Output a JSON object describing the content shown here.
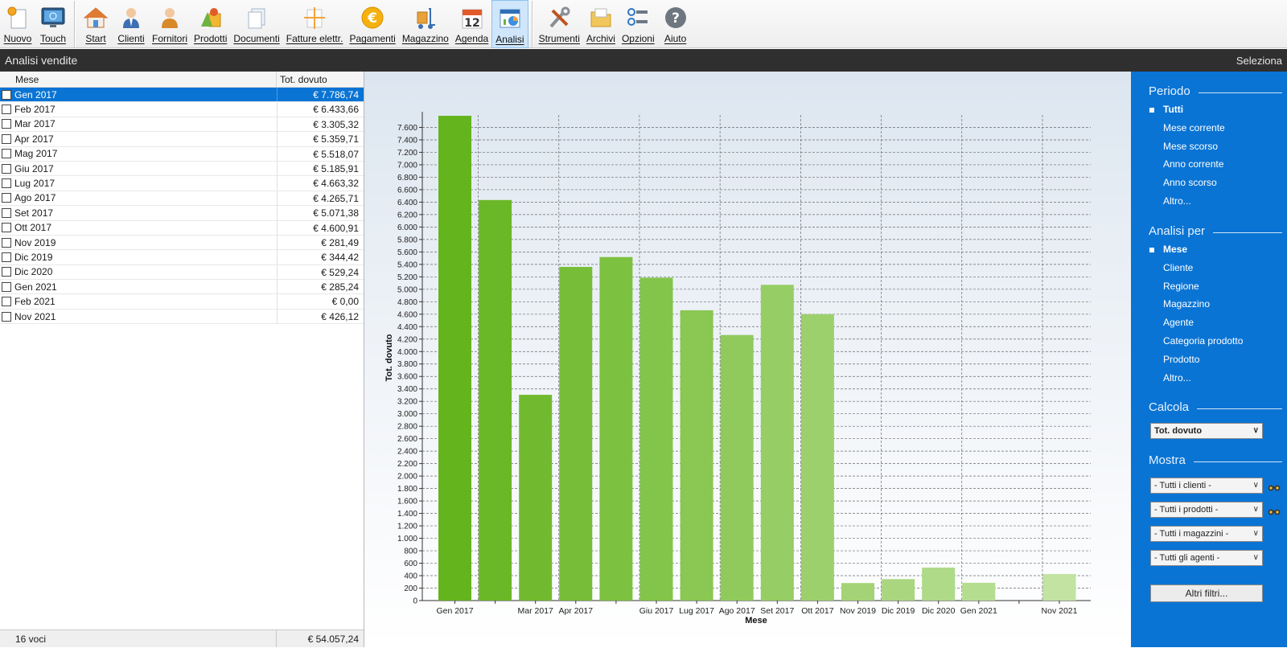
{
  "toolbar": {
    "group1": [
      {
        "key": "nuovo",
        "label": "Nuovo",
        "icon": "new-document-icon"
      },
      {
        "key": "touch",
        "label": "Touch",
        "icon": "touch-monitor-icon"
      }
    ],
    "group2": [
      {
        "key": "start",
        "label": "Start",
        "icon": "home-icon"
      },
      {
        "key": "clienti",
        "label": "Clienti",
        "icon": "customer-icon"
      },
      {
        "key": "fornitori",
        "label": "Fornitori",
        "icon": "supplier-icon"
      },
      {
        "key": "prodotti",
        "label": "Prodotti",
        "icon": "products-icon"
      },
      {
        "key": "documenti",
        "label": "Documenti",
        "icon": "documents-icon"
      },
      {
        "key": "fatture",
        "label": "Fatture elettr.",
        "icon": "e-invoice-icon"
      },
      {
        "key": "pagamenti",
        "label": "Pagamenti",
        "icon": "euro-coin-icon"
      },
      {
        "key": "magazzino",
        "label": "Magazzino",
        "icon": "warehouse-trolley-icon"
      },
      {
        "key": "agenda",
        "label": "Agenda",
        "icon": "calendar-icon",
        "day": "12"
      },
      {
        "key": "analisi",
        "label": "Analisi",
        "icon": "analysis-chart-icon",
        "active": true
      }
    ],
    "group3": [
      {
        "key": "strumenti",
        "label": "Strumenti",
        "icon": "tools-icon"
      },
      {
        "key": "archivi",
        "label": "Archivi",
        "icon": "archive-folder-icon"
      },
      {
        "key": "opzioni",
        "label": "Opzioni",
        "icon": "options-icon"
      },
      {
        "key": "aiuto",
        "label": "Aiuto",
        "icon": "help-icon"
      }
    ]
  },
  "titlebar": {
    "title": "Analisi vendite",
    "right": "Seleziona"
  },
  "table": {
    "columns": [
      "Mese",
      "Tot. dovuto"
    ],
    "rows": [
      {
        "mese": "Gen 2017",
        "tot": "€ 7.786,74",
        "selected": true
      },
      {
        "mese": "Feb 2017",
        "tot": "€ 6.433,66"
      },
      {
        "mese": "Mar 2017",
        "tot": "€ 3.305,32"
      },
      {
        "mese": "Apr 2017",
        "tot": "€ 5.359,71"
      },
      {
        "mese": "Mag 2017",
        "tot": "€ 5.518,07"
      },
      {
        "mese": "Giu 2017",
        "tot": "€ 5.185,91"
      },
      {
        "mese": "Lug 2017",
        "tot": "€ 4.663,32"
      },
      {
        "mese": "Ago 2017",
        "tot": "€ 4.265,71"
      },
      {
        "mese": "Set 2017",
        "tot": "€ 5.071,38"
      },
      {
        "mese": "Ott 2017",
        "tot": "€ 4.600,91"
      },
      {
        "mese": "Nov 2019",
        "tot": "€ 281,49"
      },
      {
        "mese": "Dic 2019",
        "tot": "€ 344,42"
      },
      {
        "mese": "Dic 2020",
        "tot": "€ 529,24"
      },
      {
        "mese": "Gen 2021",
        "tot": "€ 285,24"
      },
      {
        "mese": "Feb 2021",
        "tot": "€ 0,00"
      },
      {
        "mese": "Nov 2021",
        "tot": "€ 426,12"
      }
    ],
    "footer_count": "16 voci",
    "footer_total": "€ 54.057,24"
  },
  "chart_data": {
    "type": "bar",
    "categories": [
      "Gen 2017",
      "Feb 2017",
      "Mar 2017",
      "Apr 2017",
      "Mag 2017",
      "Giu 2017",
      "Lug 2017",
      "Ago 2017",
      "Set 2017",
      "Ott 2017",
      "Nov 2019",
      "Dic 2019",
      "Dic 2020",
      "Gen 2021",
      "Feb 2021",
      "Nov 2021"
    ],
    "shown_tick_labels": [
      "Gen 2017",
      "",
      "Mar 2017",
      "Apr 2017",
      "",
      "Giu 2017",
      "Lug 2017",
      "Ago 2017",
      "Set 2017",
      "Ott 2017",
      "Nov 2019",
      "Dic 2019",
      "Dic 2020",
      "Gen 2021",
      "",
      "Nov 2021"
    ],
    "values": [
      7786.74,
      6433.66,
      3305.32,
      5359.71,
      5518.07,
      5185.91,
      4663.32,
      4265.71,
      5071.38,
      4600.91,
      281.49,
      344.42,
      529.24,
      285.24,
      0.0,
      426.12
    ],
    "xlabel": "Mese",
    "ylabel": "Tot. dovuto",
    "ylim": [
      0,
      7800
    ],
    "ytick_step": 200,
    "ytick_labels": [
      "0",
      "200",
      "400",
      "600",
      "800",
      "1.000",
      "1.200",
      "1.400",
      "1.600",
      "1.800",
      "2.000",
      "2.200",
      "2.400",
      "2.600",
      "2.800",
      "3.000",
      "3.200",
      "3.400",
      "3.600",
      "3.800",
      "4.000",
      "4.200",
      "4.400",
      "4.600",
      "4.800",
      "5.000",
      "5.200",
      "5.400",
      "5.600",
      "5.800",
      "6.000",
      "6.200",
      "6.400",
      "6.600",
      "6.800",
      "7.000",
      "7.200",
      "7.400",
      "7.600"
    ],
    "grid": true,
    "bar_color_start": "#64b41e",
    "bar_color_end": "#c2e3a2"
  },
  "rightpanel": {
    "periodo": {
      "title": "Periodo",
      "options": [
        "Tutti",
        "Mese corrente",
        "Mese scorso",
        "Anno corrente",
        "Anno scorso",
        "Altro..."
      ],
      "selected": 0
    },
    "analisi": {
      "title": "Analisi per",
      "options": [
        "Mese",
        "Cliente",
        "Regione",
        "Magazzino",
        "Agente",
        "Categoria prodotto",
        "Prodotto",
        "Altro..."
      ],
      "selected": 0
    },
    "calcola": {
      "title": "Calcola",
      "value": "Tot. dovuto"
    },
    "mostra": {
      "title": "Mostra",
      "dropdowns": [
        " - Tutti i clienti  - ",
        " - Tutti i prodotti  - ",
        " - Tutti i magazzini  - ",
        " - Tutti gli agenti  - "
      ]
    },
    "filters_button": "Altri filtri...",
    "accent": "#0a74d4"
  }
}
